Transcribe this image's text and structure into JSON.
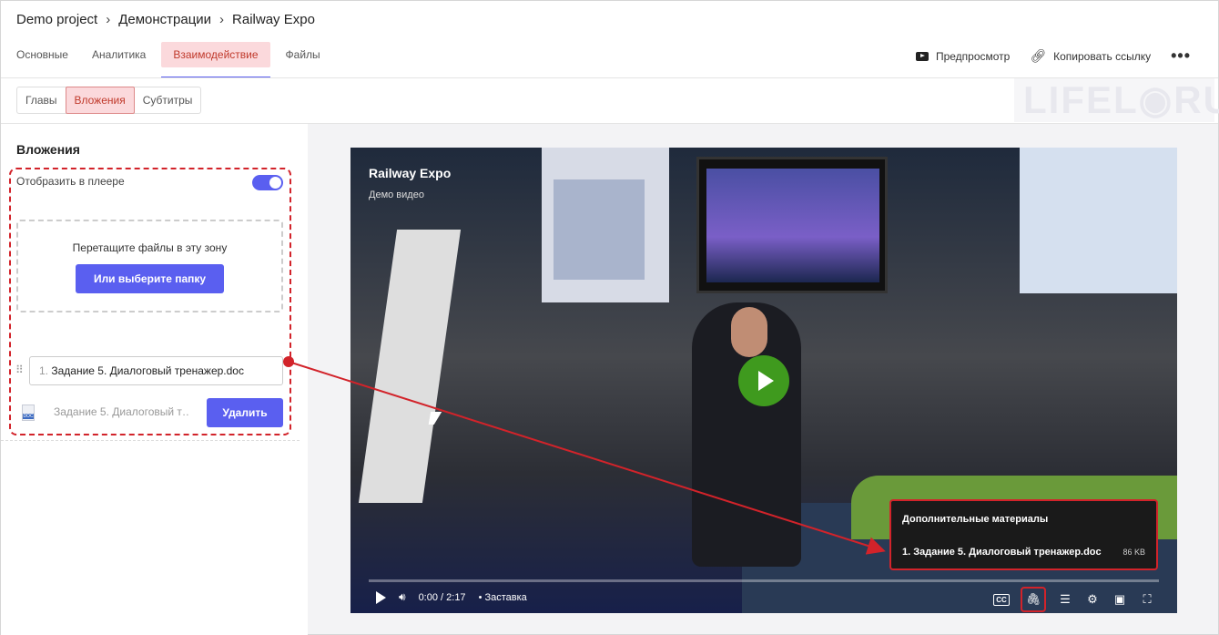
{
  "breadcrumb": {
    "items": [
      "Demo project",
      "Демонстрации",
      "Railway Expo"
    ],
    "separator": "›"
  },
  "tabs": [
    {
      "label": "Основные",
      "active": false
    },
    {
      "label": "Аналитика",
      "active": false
    },
    {
      "label": "Взаимодействие",
      "active": true
    },
    {
      "label": "Файлы",
      "active": false
    }
  ],
  "toolbar": {
    "preview_label": "Предпросмотр",
    "copy_link_label": "Копировать ссылку",
    "more_icon": "more-horizontal-icon"
  },
  "subtabs": [
    {
      "label": "Главы",
      "active": false
    },
    {
      "label": "Вложения",
      "active": true
    },
    {
      "label": "Субтитры",
      "active": false
    }
  ],
  "watermark": "LIFEL◉RU",
  "sidebar": {
    "title": "Вложения",
    "show_in_player_label": "Отобразить в плеере",
    "show_in_player_on": true,
    "dropzone_text": "Перетащите файлы в эту зону",
    "dropzone_button": "Или выберите папку",
    "attachment": {
      "number": "1.",
      "name_value": "Задание 5. Диалоговый тренажер.doc",
      "file_name": "Задание 5. Диалоговый т…",
      "file_type_badge": "DOC",
      "delete_label": "Удалить"
    }
  },
  "player": {
    "title": "Railway Expo",
    "subtitle": "Демо видео",
    "time": "0:00 / 2:17",
    "chapter": "• Заставка",
    "progress": 0.0,
    "popup": {
      "title": "Дополнительные материалы",
      "item": "1. Задание 5. Диалоговый тренажер.doc",
      "size": "86 KB"
    },
    "cc_label": "CC"
  },
  "colors": {
    "accent": "#5a5ff0",
    "active_tab_bg": "#fbd9dc",
    "highlight_red": "#d2232a",
    "play_green": "#3f9a1e"
  }
}
